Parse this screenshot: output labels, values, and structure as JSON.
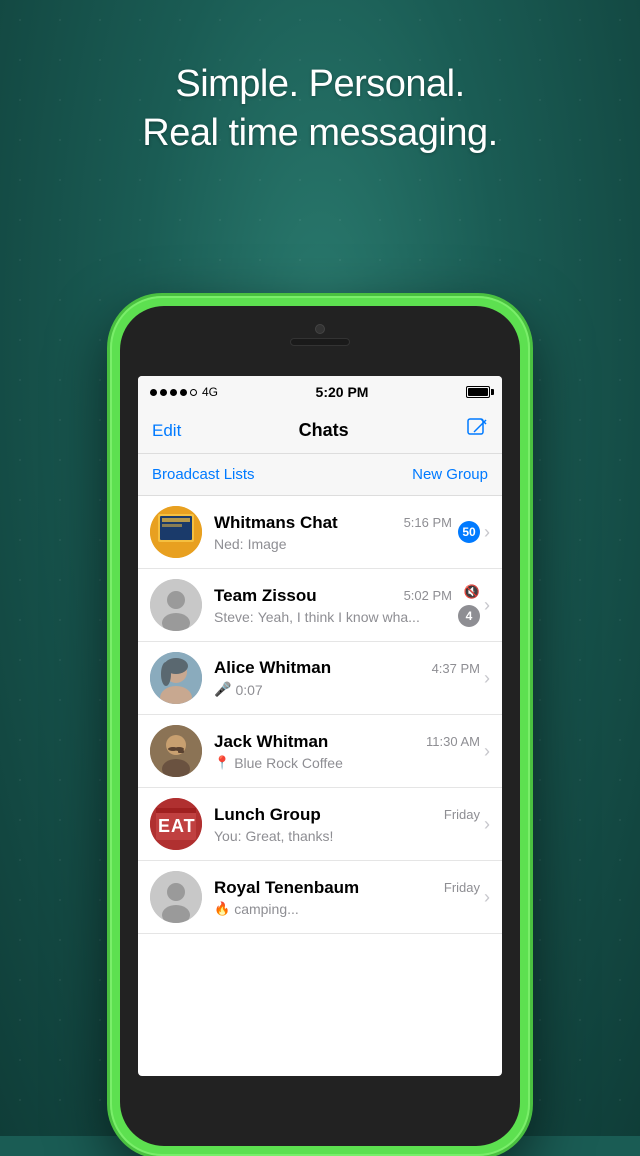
{
  "background": {
    "tagline_line1": "Simple. Personal.",
    "tagline_line2": "Real time messaging."
  },
  "status_bar": {
    "signal": "●●●●○",
    "network": "4G",
    "time": "5:20 PM",
    "battery_full": true
  },
  "nav": {
    "edit_label": "Edit",
    "title": "Chats",
    "compose_icon": "compose"
  },
  "actions": {
    "broadcast_label": "Broadcast Lists",
    "new_group_label": "New Group"
  },
  "chats": [
    {
      "id": "whitmans",
      "name": "Whitmans Chat",
      "time": "5:16 PM",
      "preview_sender": "Ned:",
      "preview_content": "Image",
      "badge": "50",
      "badge_muted": false,
      "avatar_type": "image_whitmans"
    },
    {
      "id": "team-zissou",
      "name": "Team Zissou",
      "time": "5:02 PM",
      "preview_sender": "Steve:",
      "preview_content": "Yeah, I think I know wha...",
      "badge": "4",
      "badge_muted": true,
      "avatar_type": "person_gray"
    },
    {
      "id": "alice",
      "name": "Alice Whitman",
      "time": "4:37 PM",
      "preview_sender": "",
      "preview_content": "0:07",
      "preview_icon": "mic",
      "badge": null,
      "avatar_type": "person_photo_alice"
    },
    {
      "id": "jack",
      "name": "Jack Whitman",
      "time": "11:30 AM",
      "preview_sender": "",
      "preview_content": "Blue Rock Coffee",
      "preview_icon": "location",
      "badge": null,
      "avatar_type": "person_photo_jack"
    },
    {
      "id": "lunch",
      "name": "Lunch Group",
      "time": "Friday",
      "preview_sender": "You:",
      "preview_content": "Great, thanks!",
      "badge": null,
      "avatar_type": "eat_sign"
    },
    {
      "id": "royal",
      "name": "Royal Tenenbaum",
      "time": "Friday",
      "preview_sender": "",
      "preview_content": "camping...",
      "preview_icon": "fire",
      "badge": null,
      "avatar_type": "person_gray"
    }
  ]
}
